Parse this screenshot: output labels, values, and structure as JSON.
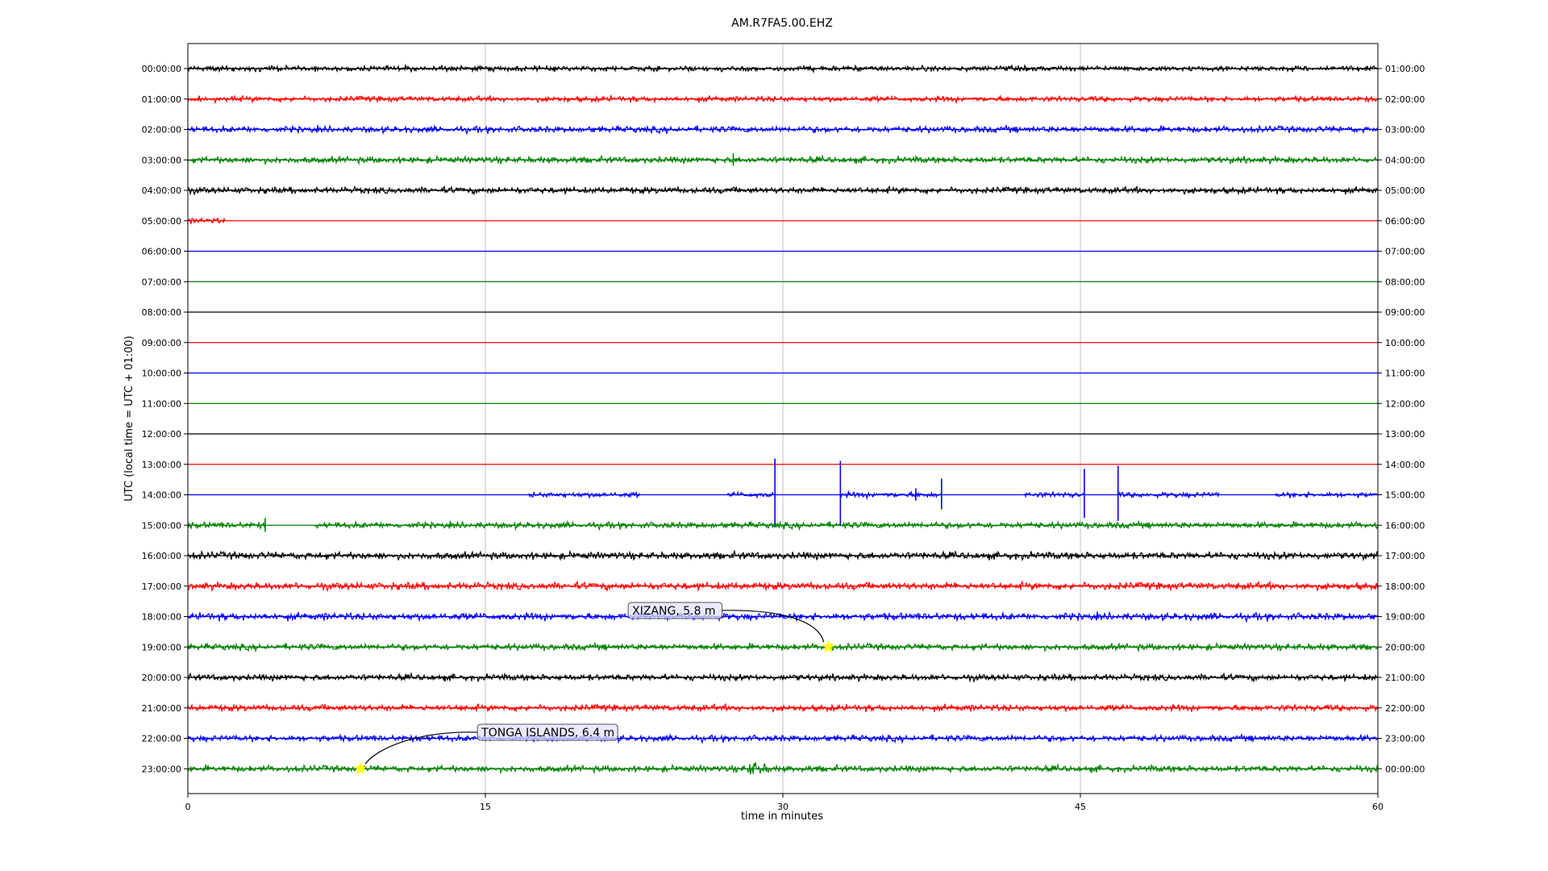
{
  "chart_data": {
    "type": "line",
    "title": "AM.R7FA5.00.EHZ",
    "xlabel": "time in minutes",
    "ylabel": "UTC (local time = UTC + 01:00)",
    "xlim": [
      0,
      60
    ],
    "xticks": [
      "0",
      "15",
      "30",
      "45",
      "60"
    ],
    "xgrid": true,
    "colors": [
      "#000000",
      "#ff0000",
      "#0000ff",
      "#008000"
    ],
    "rows": [
      {
        "utc": "00:00:00",
        "local": "01:00:00",
        "activity": "noise",
        "amp": 3
      },
      {
        "utc": "01:00:00",
        "local": "02:00:00",
        "activity": "noise",
        "amp": 3
      },
      {
        "utc": "02:00:00",
        "local": "03:00:00",
        "activity": "noise",
        "amp": 3.5
      },
      {
        "utc": "03:00:00",
        "local": "04:00:00",
        "activity": "noise",
        "amp": 3.5,
        "spikes": [
          {
            "t": 27.5,
            "a": 8
          }
        ]
      },
      {
        "utc": "04:00:00",
        "local": "05:00:00",
        "activity": "noise",
        "amp": 3.5
      },
      {
        "utc": "05:00:00",
        "local": "06:00:00",
        "activity": "segments",
        "amp": 3,
        "segments": [
          [
            0,
            1.9
          ]
        ]
      },
      {
        "utc": "06:00:00",
        "local": "07:00:00",
        "activity": "flat"
      },
      {
        "utc": "07:00:00",
        "local": "08:00:00",
        "activity": "flat"
      },
      {
        "utc": "08:00:00",
        "local": "09:00:00",
        "activity": "flat"
      },
      {
        "utc": "09:00:00",
        "local": "10:00:00",
        "activity": "flat"
      },
      {
        "utc": "10:00:00",
        "local": "11:00:00",
        "activity": "flat"
      },
      {
        "utc": "11:00:00",
        "local": "12:00:00",
        "activity": "flat"
      },
      {
        "utc": "12:00:00",
        "local": "13:00:00",
        "activity": "flat"
      },
      {
        "utc": "13:00:00",
        "local": "14:00:00",
        "activity": "flat"
      },
      {
        "utc": "14:00:00",
        "local": "15:00:00",
        "activity": "segments",
        "amp": 3,
        "segments": [
          [
            17.2,
            22.8
          ],
          [
            27.2,
            29.6
          ],
          [
            32.9,
            38.0
          ],
          [
            42.2,
            45.2
          ],
          [
            46.9,
            52.0
          ],
          [
            54.8,
            60
          ]
        ],
        "spikes": [
          {
            "t": 29.6,
            "a": 45
          },
          {
            "t": 32.9,
            "a": 42
          },
          {
            "t": 38.0,
            "a": 20
          },
          {
            "t": 45.2,
            "a": 32
          },
          {
            "t": 46.9,
            "a": 36
          },
          {
            "t": 36.7,
            "a": 8
          }
        ]
      },
      {
        "utc": "15:00:00",
        "local": "16:00:00",
        "activity": "segments",
        "amp": 3.5,
        "segments": [
          [
            0,
            3.9
          ],
          [
            6.4,
            60
          ]
        ],
        "spikes": [
          {
            "t": 3.9,
            "a": 9
          }
        ]
      },
      {
        "utc": "16:00:00",
        "local": "17:00:00",
        "activity": "noise",
        "amp": 4
      },
      {
        "utc": "17:00:00",
        "local": "18:00:00",
        "activity": "noise",
        "amp": 4
      },
      {
        "utc": "18:00:00",
        "local": "19:00:00",
        "activity": "noise",
        "amp": 4
      },
      {
        "utc": "19:00:00",
        "local": "20:00:00",
        "activity": "noise",
        "amp": 3.5
      },
      {
        "utc": "20:00:00",
        "local": "21:00:00",
        "activity": "noise",
        "amp": 3.5
      },
      {
        "utc": "21:00:00",
        "local": "22:00:00",
        "activity": "noise",
        "amp": 3.5
      },
      {
        "utc": "22:00:00",
        "local": "23:00:00",
        "activity": "noise",
        "amp": 3.5
      },
      {
        "utc": "23:00:00",
        "local": "00:00:00",
        "activity": "noise",
        "amp": 3.5,
        "bursts": [
          {
            "start": 28.2,
            "dur": 2.0,
            "a": 11
          }
        ]
      }
    ],
    "events": [
      {
        "label": "XIZANG, 5.8 m",
        "row": 19,
        "t": 32.3,
        "marker_color": "#ffff00"
      },
      {
        "label": "TONGA ISLANDS, 6.4 m",
        "row": 23,
        "t": 8.7,
        "marker_color": "#ffff00"
      }
    ]
  }
}
